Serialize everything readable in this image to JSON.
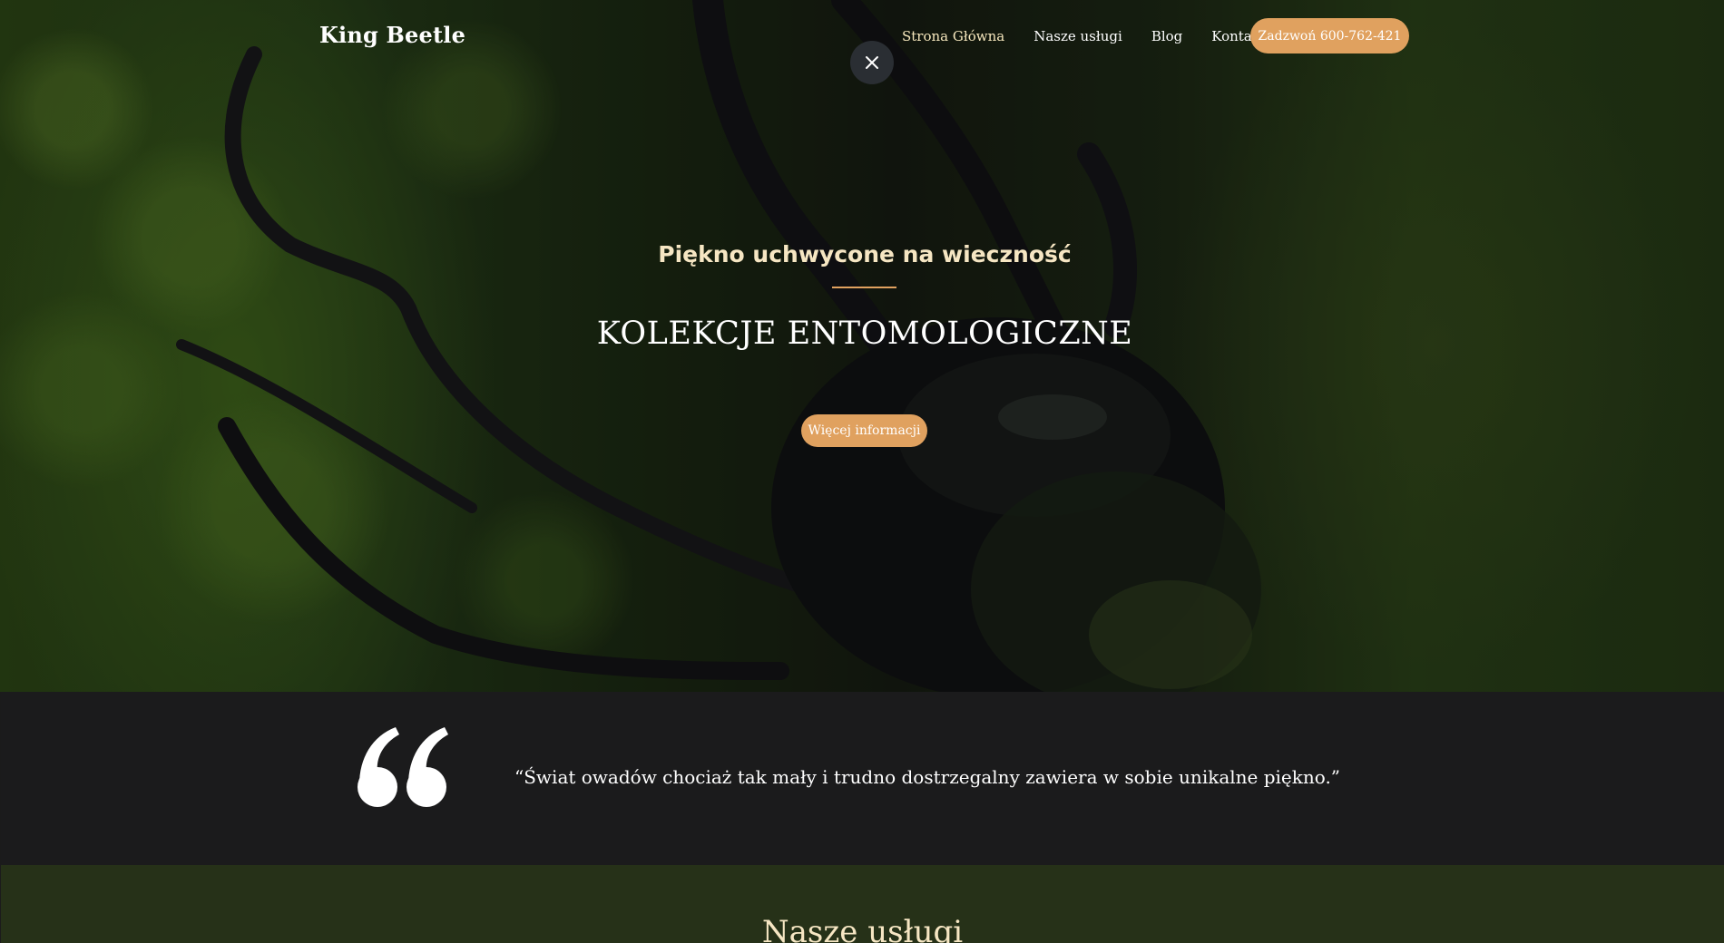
{
  "header": {
    "logo": "King Beetle",
    "nav": [
      {
        "label": "Strona Główna"
      },
      {
        "label": "Nasze usługi"
      },
      {
        "label": "Blog"
      },
      {
        "label": "Kontakt"
      }
    ],
    "call_button": "Zadzwoń 600-762-421",
    "close_icon": "close-icon"
  },
  "hero": {
    "kicker": "Piękno uchwycone na wieczność",
    "title": "KOLEKCJE ENTOMOLOGICZNE",
    "button": "Więcej informacji",
    "image": "beetle-on-mossy-bark"
  },
  "quote": {
    "icon": "quote-icon",
    "text": "“Świat owadów chociaż tak mały i trudno dostrzegalny zawiera w sobie unikalne piękno.”"
  },
  "services": {
    "title": "Nasze usługi"
  },
  "colors": {
    "accent": "#e0a15f",
    "cream": "#f6e6c3",
    "quote_bg": "#1b1b1c",
    "services_bg": "#263118"
  }
}
